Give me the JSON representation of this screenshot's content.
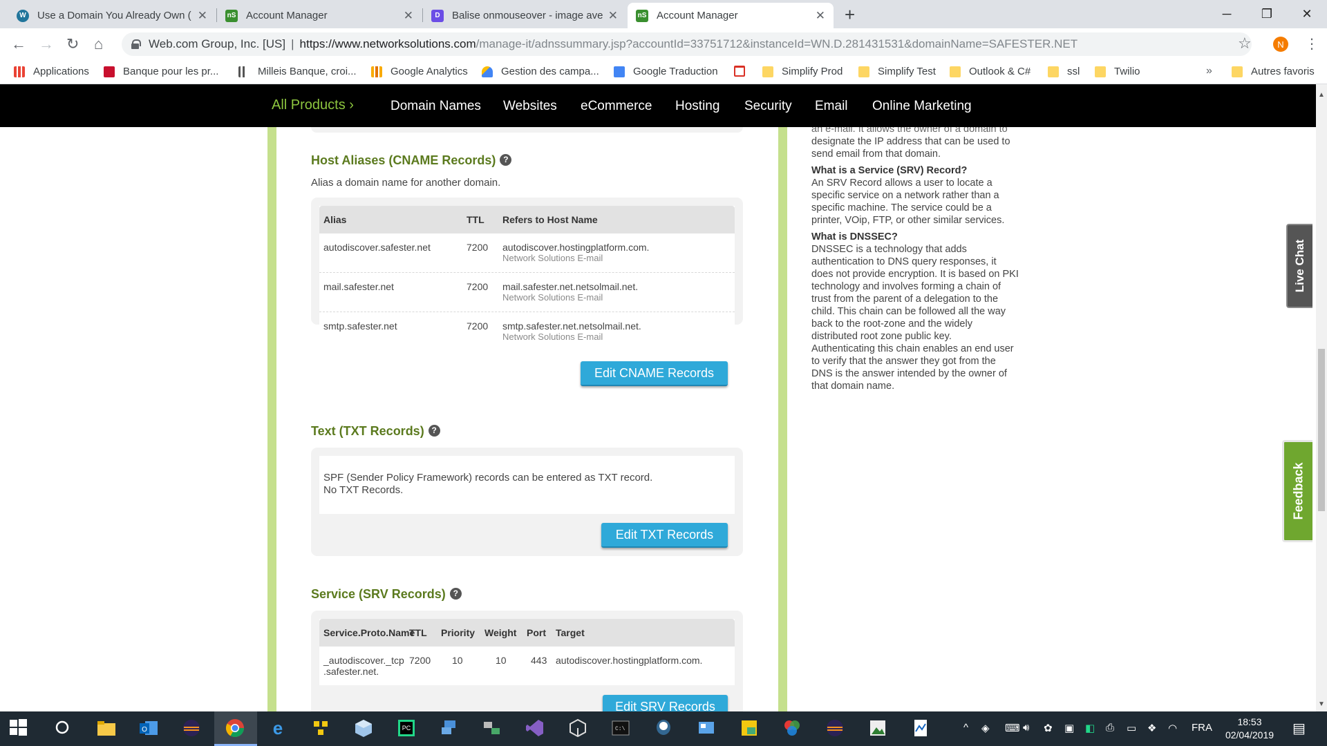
{
  "browser": {
    "tabs": [
      {
        "title": "Use a Domain You Already Own (",
        "icon": "wordpress-icon"
      },
      {
        "title": "Account Manager",
        "icon": "ns-icon"
      },
      {
        "title": "Balise onmouseover - image ave",
        "icon": "d-icon"
      },
      {
        "title": "Account Manager",
        "icon": "ns-icon",
        "active": true
      }
    ],
    "address": {
      "org": "Web.com Group, Inc. [US]",
      "url_main": "https://www.networksolutions.com",
      "url_rest": "/manage-it/adnssummary.jsp?accountId=33751712&instanceId=WN.D.281431531&domainName=SAFESTER.NET"
    },
    "profile_initial": "N",
    "bookmarks": [
      {
        "label": "Applications",
        "icon": "apps-grid-icon"
      },
      {
        "label": "Banque pour les pr...",
        "icon": "bank-icon"
      },
      {
        "label": "Milleis Banque, croi...",
        "icon": "milleis-icon"
      },
      {
        "label": "Google Analytics",
        "icon": "analytics-icon"
      },
      {
        "label": "Gestion des campa...",
        "icon": "ads-icon"
      },
      {
        "label": "Google Traduction",
        "icon": "translate-icon"
      },
      {
        "label": "",
        "icon": "gmail-icon"
      },
      {
        "label": "Simplify Prod",
        "icon": "folder-icon"
      },
      {
        "label": "Simplify Test",
        "icon": "folder-icon"
      },
      {
        "label": "Outlook & C#",
        "icon": "folder-icon"
      },
      {
        "label": "ssl",
        "icon": "folder-icon"
      },
      {
        "label": "Twilio",
        "icon": "folder-icon"
      },
      {
        "label": "Autres favoris",
        "icon": "folder-icon"
      }
    ],
    "more_bookmarks": "»"
  },
  "sitenav": {
    "all_products": "All Products ›",
    "items": [
      "Domain Names",
      "Websites",
      "eCommerce",
      "Hosting",
      "Security",
      "Email",
      "Online Marketing"
    ]
  },
  "cname": {
    "title": "Host Aliases (CNAME Records)",
    "desc": "Alias a domain name for another domain.",
    "headers": [
      "Alias",
      "TTL",
      "Refers to Host Name"
    ],
    "rows": [
      {
        "alias": "autodiscover.safester.net",
        "ttl": "7200",
        "host": "autodiscover.hostingplatform.com.",
        "note": "Network Solutions E-mail"
      },
      {
        "alias": "mail.safester.net",
        "ttl": "7200",
        "host": "mail.safester.net.netsolmail.net.",
        "note": "Network Solutions E-mail"
      },
      {
        "alias": "smtp.safester.net",
        "ttl": "7200",
        "host": "smtp.safester.net.netsolmail.net.",
        "note": "Network Solutions E-mail"
      }
    ],
    "button": "Edit CNAME Records"
  },
  "txt": {
    "title": "Text (TXT Records)",
    "line1": "SPF (Sender Policy Framework) records can be entered as TXT record.",
    "line2": "No TXT Records.",
    "button": "Edit TXT Records"
  },
  "srv": {
    "title": "Service (SRV Records)",
    "headers": [
      "Service.Proto.Name",
      "TTL",
      "Priority",
      "Weight",
      "Port",
      "Target"
    ],
    "rows": [
      {
        "name1": "_autodiscover._tcp",
        "name2": ".safester.net.",
        "ttl": "7200",
        "priority": "10",
        "weight": "10",
        "port": "443",
        "target": "autodiscover.hostingplatform.com."
      }
    ],
    "button": "Edit SRV Records"
  },
  "sidebar": {
    "cutoff_line1": "an e-mail. It allows the owner of a domain to",
    "cutoff_line2": "designate the IP address that can be used to",
    "cutoff_line3": "send email from that domain.",
    "srv_q": "What is a Service (SRV) Record?",
    "srv_lines": [
      "An SRV Record allows a user to locate a",
      "specific service on a network rather than a",
      "specific machine.  The service could be a",
      "printer, VOip, FTP, or other similar services."
    ],
    "dnssec_q": "What is DNSSEC?",
    "dnssec_lines": [
      "DNSSEC is a technology that adds",
      "authentication to DNS query responses, it",
      "does not provide encryption. It is based on PKI",
      "technology and involves forming a chain of",
      "trust from the parent of a delegation to the",
      "child. This chain can be followed all the way",
      "back to the root-zone and the widely",
      "distributed root zone public key.",
      "Authenticating this chain enables an end user",
      "to verify that the answer they got from the",
      "DNS is the answer intended by the owner of",
      "that domain name."
    ]
  },
  "widgets": {
    "live_chat": "Live Chat",
    "feedback": "Feedback"
  },
  "taskbar": {
    "lang": "FRA",
    "time": "18:53",
    "date": "02/04/2019"
  },
  "colors": {
    "accent_green": "#8dc63f",
    "title_green": "#5b7a1e",
    "button_blue": "#2fa9d9"
  }
}
